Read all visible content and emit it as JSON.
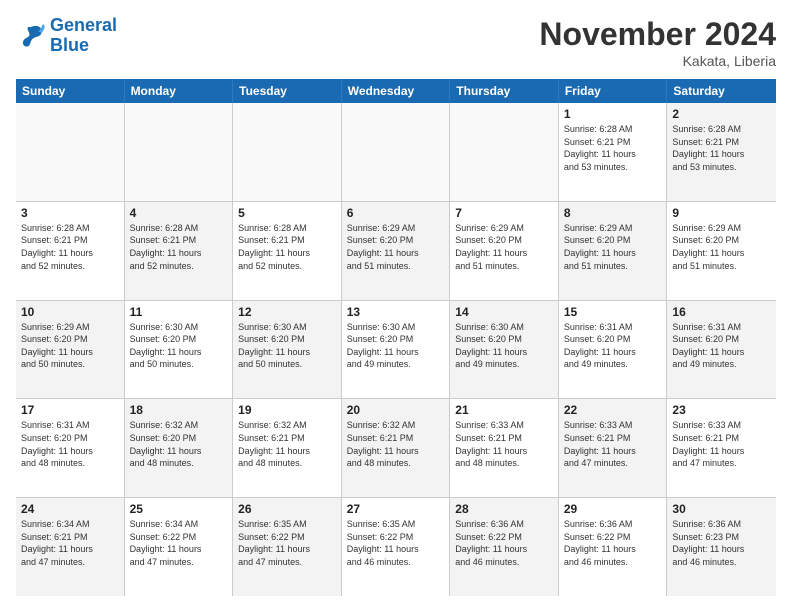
{
  "logo": {
    "line1": "General",
    "line2": "Blue"
  },
  "header": {
    "month": "November 2024",
    "location": "Kakata, Liberia"
  },
  "days_of_week": [
    "Sunday",
    "Monday",
    "Tuesday",
    "Wednesday",
    "Thursday",
    "Friday",
    "Saturday"
  ],
  "weeks": [
    [
      {
        "day": "",
        "info": "",
        "shaded": false,
        "empty": true
      },
      {
        "day": "",
        "info": "",
        "shaded": false,
        "empty": true
      },
      {
        "day": "",
        "info": "",
        "shaded": false,
        "empty": true
      },
      {
        "day": "",
        "info": "",
        "shaded": false,
        "empty": true
      },
      {
        "day": "",
        "info": "",
        "shaded": false,
        "empty": true
      },
      {
        "day": "1",
        "info": "Sunrise: 6:28 AM\nSunset: 6:21 PM\nDaylight: 11 hours\nand 53 minutes.",
        "shaded": false,
        "empty": false
      },
      {
        "day": "2",
        "info": "Sunrise: 6:28 AM\nSunset: 6:21 PM\nDaylight: 11 hours\nand 53 minutes.",
        "shaded": true,
        "empty": false
      }
    ],
    [
      {
        "day": "3",
        "info": "Sunrise: 6:28 AM\nSunset: 6:21 PM\nDaylight: 11 hours\nand 52 minutes.",
        "shaded": false,
        "empty": false
      },
      {
        "day": "4",
        "info": "Sunrise: 6:28 AM\nSunset: 6:21 PM\nDaylight: 11 hours\nand 52 minutes.",
        "shaded": true,
        "empty": false
      },
      {
        "day": "5",
        "info": "Sunrise: 6:28 AM\nSunset: 6:21 PM\nDaylight: 11 hours\nand 52 minutes.",
        "shaded": false,
        "empty": false
      },
      {
        "day": "6",
        "info": "Sunrise: 6:29 AM\nSunset: 6:20 PM\nDaylight: 11 hours\nand 51 minutes.",
        "shaded": true,
        "empty": false
      },
      {
        "day": "7",
        "info": "Sunrise: 6:29 AM\nSunset: 6:20 PM\nDaylight: 11 hours\nand 51 minutes.",
        "shaded": false,
        "empty": false
      },
      {
        "day": "8",
        "info": "Sunrise: 6:29 AM\nSunset: 6:20 PM\nDaylight: 11 hours\nand 51 minutes.",
        "shaded": true,
        "empty": false
      },
      {
        "day": "9",
        "info": "Sunrise: 6:29 AM\nSunset: 6:20 PM\nDaylight: 11 hours\nand 51 minutes.",
        "shaded": false,
        "empty": false
      }
    ],
    [
      {
        "day": "10",
        "info": "Sunrise: 6:29 AM\nSunset: 6:20 PM\nDaylight: 11 hours\nand 50 minutes.",
        "shaded": true,
        "empty": false
      },
      {
        "day": "11",
        "info": "Sunrise: 6:30 AM\nSunset: 6:20 PM\nDaylight: 11 hours\nand 50 minutes.",
        "shaded": false,
        "empty": false
      },
      {
        "day": "12",
        "info": "Sunrise: 6:30 AM\nSunset: 6:20 PM\nDaylight: 11 hours\nand 50 minutes.",
        "shaded": true,
        "empty": false
      },
      {
        "day": "13",
        "info": "Sunrise: 6:30 AM\nSunset: 6:20 PM\nDaylight: 11 hours\nand 49 minutes.",
        "shaded": false,
        "empty": false
      },
      {
        "day": "14",
        "info": "Sunrise: 6:30 AM\nSunset: 6:20 PM\nDaylight: 11 hours\nand 49 minutes.",
        "shaded": true,
        "empty": false
      },
      {
        "day": "15",
        "info": "Sunrise: 6:31 AM\nSunset: 6:20 PM\nDaylight: 11 hours\nand 49 minutes.",
        "shaded": false,
        "empty": false
      },
      {
        "day": "16",
        "info": "Sunrise: 6:31 AM\nSunset: 6:20 PM\nDaylight: 11 hours\nand 49 minutes.",
        "shaded": true,
        "empty": false
      }
    ],
    [
      {
        "day": "17",
        "info": "Sunrise: 6:31 AM\nSunset: 6:20 PM\nDaylight: 11 hours\nand 48 minutes.",
        "shaded": false,
        "empty": false
      },
      {
        "day": "18",
        "info": "Sunrise: 6:32 AM\nSunset: 6:20 PM\nDaylight: 11 hours\nand 48 minutes.",
        "shaded": true,
        "empty": false
      },
      {
        "day": "19",
        "info": "Sunrise: 6:32 AM\nSunset: 6:21 PM\nDaylight: 11 hours\nand 48 minutes.",
        "shaded": false,
        "empty": false
      },
      {
        "day": "20",
        "info": "Sunrise: 6:32 AM\nSunset: 6:21 PM\nDaylight: 11 hours\nand 48 minutes.",
        "shaded": true,
        "empty": false
      },
      {
        "day": "21",
        "info": "Sunrise: 6:33 AM\nSunset: 6:21 PM\nDaylight: 11 hours\nand 48 minutes.",
        "shaded": false,
        "empty": false
      },
      {
        "day": "22",
        "info": "Sunrise: 6:33 AM\nSunset: 6:21 PM\nDaylight: 11 hours\nand 47 minutes.",
        "shaded": true,
        "empty": false
      },
      {
        "day": "23",
        "info": "Sunrise: 6:33 AM\nSunset: 6:21 PM\nDaylight: 11 hours\nand 47 minutes.",
        "shaded": false,
        "empty": false
      }
    ],
    [
      {
        "day": "24",
        "info": "Sunrise: 6:34 AM\nSunset: 6:21 PM\nDaylight: 11 hours\nand 47 minutes.",
        "shaded": true,
        "empty": false
      },
      {
        "day": "25",
        "info": "Sunrise: 6:34 AM\nSunset: 6:22 PM\nDaylight: 11 hours\nand 47 minutes.",
        "shaded": false,
        "empty": false
      },
      {
        "day": "26",
        "info": "Sunrise: 6:35 AM\nSunset: 6:22 PM\nDaylight: 11 hours\nand 47 minutes.",
        "shaded": true,
        "empty": false
      },
      {
        "day": "27",
        "info": "Sunrise: 6:35 AM\nSunset: 6:22 PM\nDaylight: 11 hours\nand 46 minutes.",
        "shaded": false,
        "empty": false
      },
      {
        "day": "28",
        "info": "Sunrise: 6:36 AM\nSunset: 6:22 PM\nDaylight: 11 hours\nand 46 minutes.",
        "shaded": true,
        "empty": false
      },
      {
        "day": "29",
        "info": "Sunrise: 6:36 AM\nSunset: 6:22 PM\nDaylight: 11 hours\nand 46 minutes.",
        "shaded": false,
        "empty": false
      },
      {
        "day": "30",
        "info": "Sunrise: 6:36 AM\nSunset: 6:23 PM\nDaylight: 11 hours\nand 46 minutes.",
        "shaded": true,
        "empty": false
      }
    ]
  ]
}
